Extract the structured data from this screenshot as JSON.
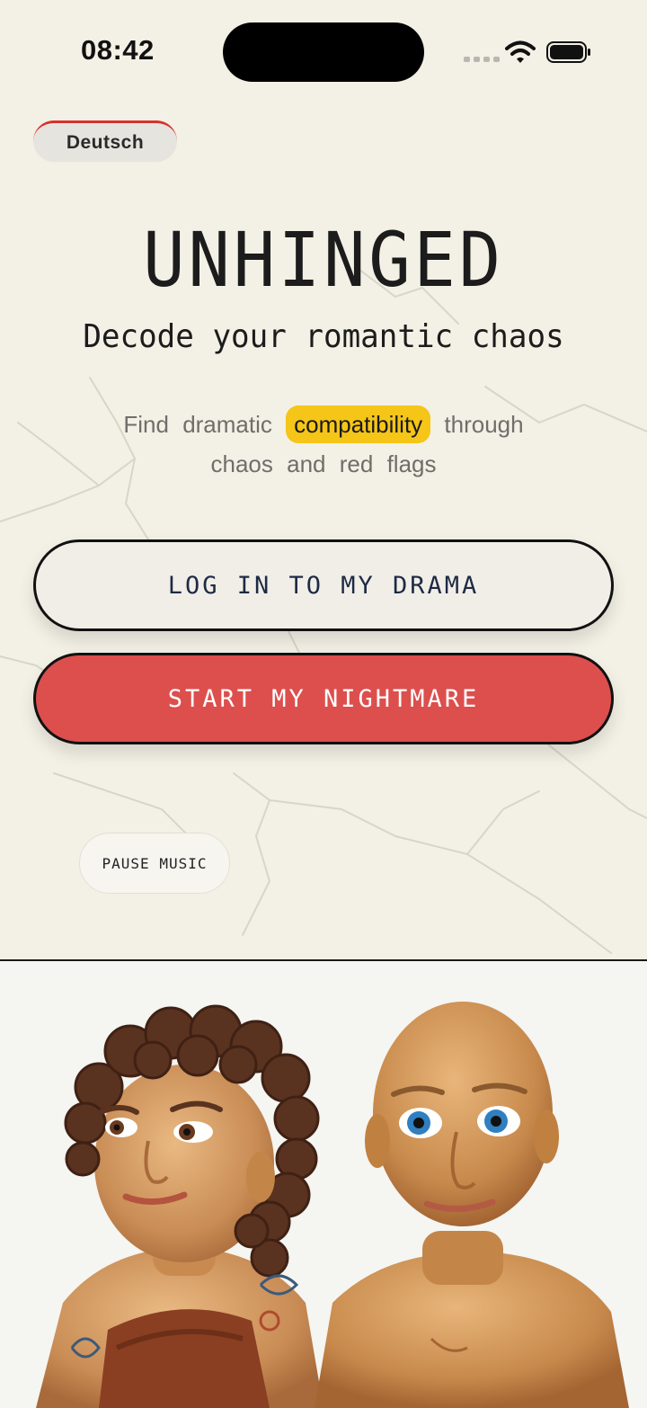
{
  "status_bar": {
    "time": "08:42"
  },
  "language": {
    "label": "Deutsch"
  },
  "hero": {
    "title": "UNHINGED",
    "subtitle": "Decode your romantic chaos",
    "tagline_words": [
      "Find",
      "dramatic",
      "compatibility",
      "through",
      "chaos",
      "and",
      "red",
      "flags"
    ],
    "highlighted_word": "compatibility"
  },
  "actions": {
    "login_label": "LOG IN TO MY DRAMA",
    "start_label": "START MY NIGHTMARE",
    "pause_label": "PAUSE MUSIC"
  },
  "colors": {
    "background": "#f3f0e5",
    "accent_red": "#dc4f4d",
    "highlight_yellow": "#f5c518",
    "ink": "#1c1c1c"
  },
  "icons": [
    "wifi-icon",
    "battery-icon",
    "cellular-signal-icon"
  ]
}
